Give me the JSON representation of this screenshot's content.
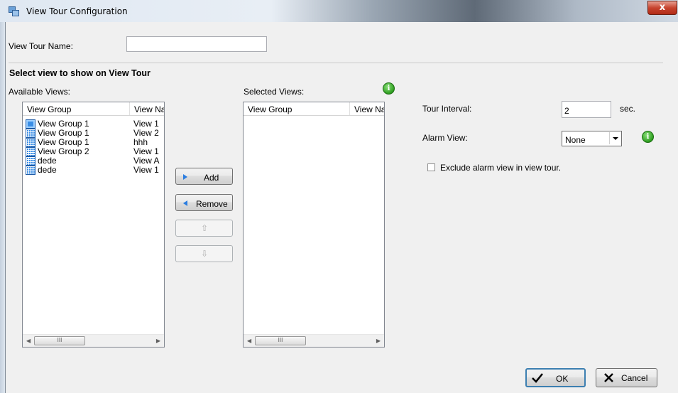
{
  "window": {
    "title": "View Tour Configuration",
    "close_label": "x"
  },
  "form": {
    "tour_name_label": "View Tour Name:",
    "tour_name_value": "",
    "section_title": "Select view to show on View Tour",
    "available_label": "Available Views:",
    "selected_label": "Selected Views:"
  },
  "available_views": {
    "columns": [
      "View Group",
      "View Na"
    ],
    "rows": [
      {
        "group": "View Group 1",
        "view": "View 1",
        "icon": "single-view-icon"
      },
      {
        "group": "View Group 1",
        "view": "View 2",
        "icon": "grid-view-icon"
      },
      {
        "group": "View Group 1",
        "view": "hhh",
        "icon": "grid-view-icon"
      },
      {
        "group": "View Group 2",
        "view": "View 1",
        "icon": "grid-view-icon"
      },
      {
        "group": "dede",
        "view": "View A",
        "icon": "grid-view-icon"
      },
      {
        "group": "dede",
        "view": "View 1",
        "icon": "grid-view-icon"
      }
    ],
    "scroll_thumb": "III"
  },
  "selected_views": {
    "columns": [
      "View Group",
      "View Na"
    ],
    "rows": [],
    "scroll_thumb": "III"
  },
  "transfer": {
    "add_label": "Add",
    "remove_label": "Remove",
    "up_label": "⇧",
    "down_label": "⇩"
  },
  "settings": {
    "interval_label": "Tour Interval:",
    "interval_value": "2",
    "interval_unit": "sec.",
    "alarm_label": "Alarm View:",
    "alarm_value": "None",
    "exclude_label": "Exclude alarm view in view tour.",
    "exclude_checked": false
  },
  "footer": {
    "ok_label": "OK",
    "cancel_label": "Cancel"
  },
  "info_glyph": "i"
}
